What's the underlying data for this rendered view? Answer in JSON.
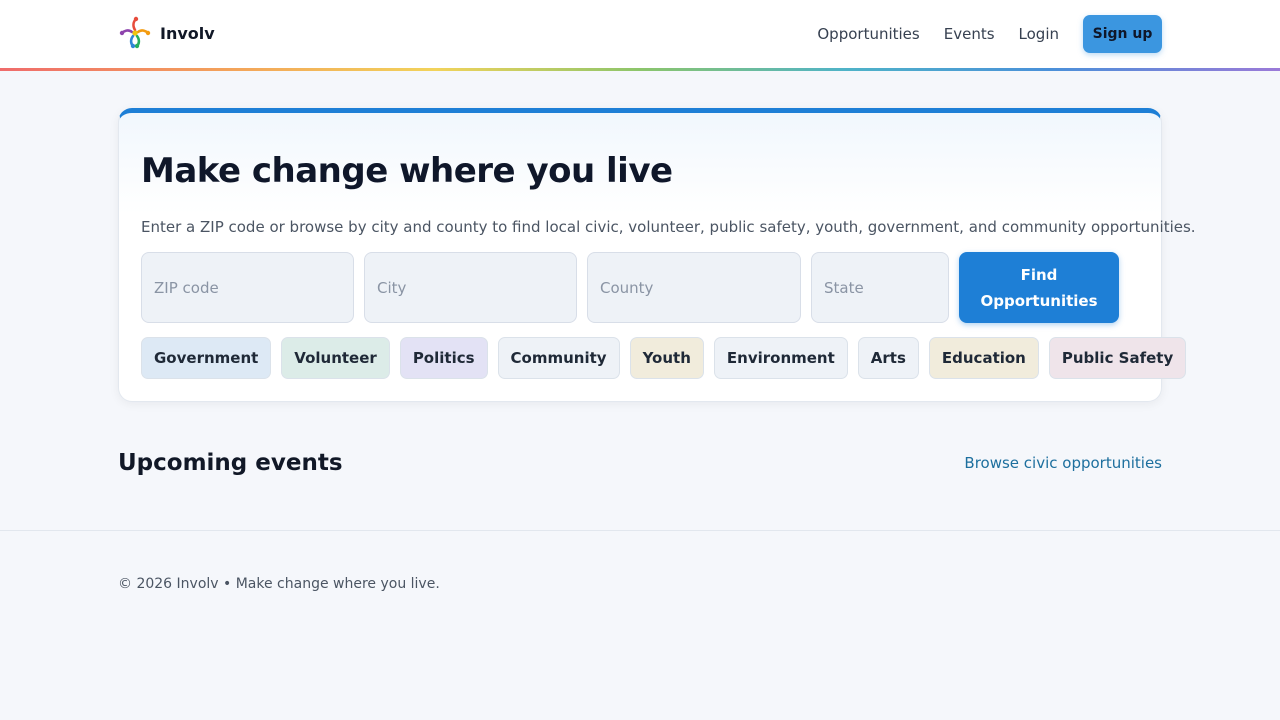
{
  "header": {
    "brand_name": "Involv",
    "logo_icon": "colorful-people-star-icon",
    "nav": {
      "opportunities": "Opportunities",
      "events": "Events",
      "login": "Login"
    },
    "signup_label": "Sign up"
  },
  "colors": {
    "accent": "#1e7fd6",
    "signup": "#3b96e0",
    "rainbow": [
      "#ef6b6b",
      "#f3a35a",
      "#f2d35b",
      "#8cc56b",
      "#4fb3c8",
      "#4a90d9",
      "#9b7ad8"
    ]
  },
  "hero": {
    "title": "Make change where you live",
    "subtitle": "Enter a ZIP code or browse by city and county to find local civic, volunteer, public safety, youth, government, and community opportunities.",
    "fields": {
      "zip_placeholder": "ZIP code",
      "city_placeholder": "City",
      "county_placeholder": "County",
      "state_placeholder": "State"
    },
    "find_button": "Find Opportunities",
    "chips": [
      {
        "label": "Government",
        "color": "#dde9f5"
      },
      {
        "label": "Volunteer",
        "color": "#dcece8"
      },
      {
        "label": "Politics",
        "color": "#e3e2f5"
      },
      {
        "label": "Community",
        "color": "#eef2f7"
      },
      {
        "label": "Youth",
        "color": "#f1ecdc"
      },
      {
        "label": "Environment",
        "color": "#eef2f7"
      },
      {
        "label": "Arts",
        "color": "#eef2f7"
      },
      {
        "label": "Education",
        "color": "#f1ecdc"
      },
      {
        "label": "Public Safety",
        "color": "#efe4ea"
      }
    ]
  },
  "upcoming": {
    "title": "Upcoming events",
    "browse_link": "Browse civic opportunities"
  },
  "footer": {
    "text": "© 2026 Involv • Make change where you live."
  }
}
